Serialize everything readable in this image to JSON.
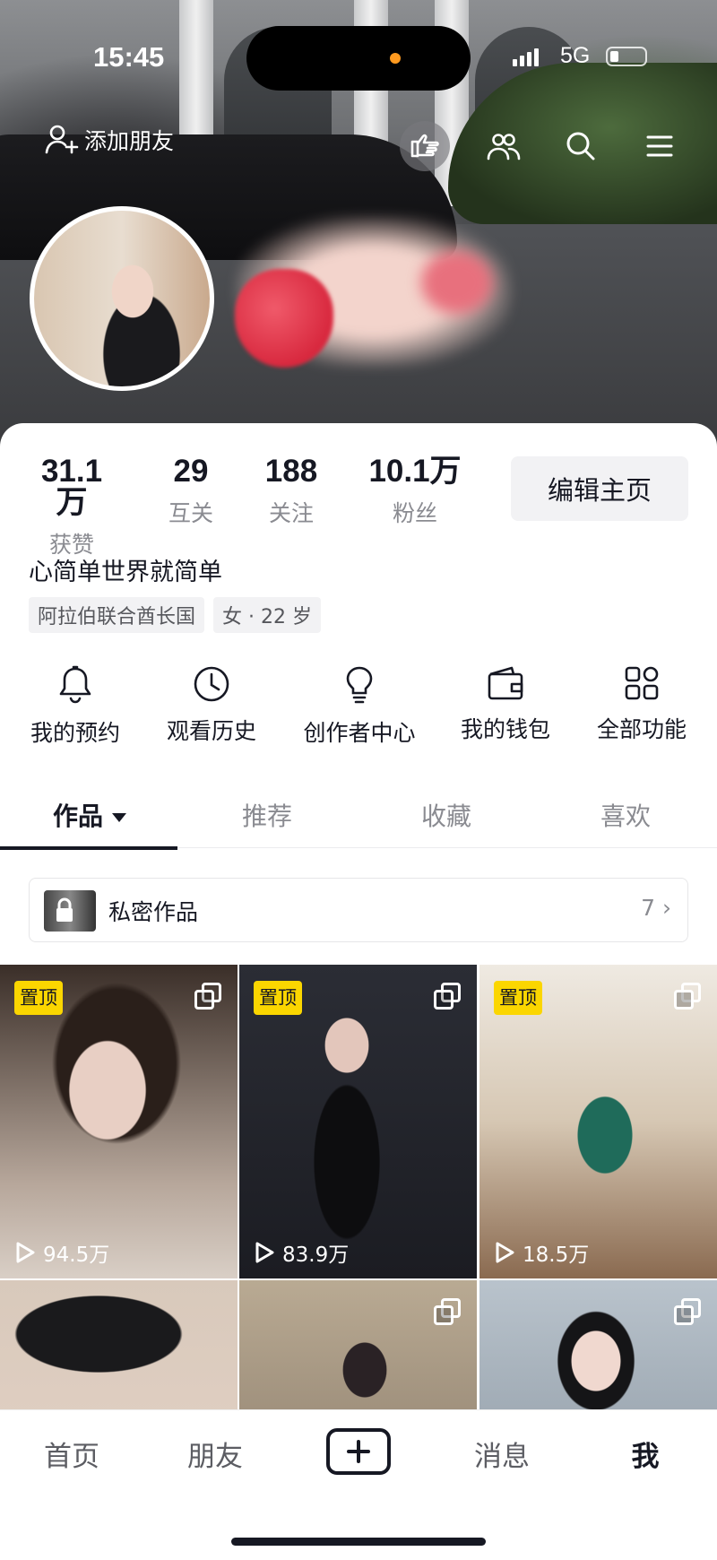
{
  "status_bar": {
    "time": "15:45",
    "network": "5G"
  },
  "header": {
    "add_friend_label": "添加朋友",
    "icons": [
      "add-friend-icon",
      "visitor-hand-icon",
      "friends-icon",
      "search-icon",
      "menu-icon"
    ]
  },
  "profile": {
    "stats": [
      {
        "value": "31.1万",
        "label": "获赞"
      },
      {
        "value": "29",
        "label": "互关"
      },
      {
        "value": "188",
        "label": "关注"
      },
      {
        "value": "10.1万",
        "label": "粉丝"
      }
    ],
    "edit_label": "编辑主页",
    "bio": "心简单世界就简单",
    "tags": [
      "阿拉伯联合酋长国",
      "女 · 22 岁"
    ]
  },
  "shortcuts": [
    {
      "label": "我的预约",
      "icon": "bell-icon"
    },
    {
      "label": "观看历史",
      "icon": "clock-icon"
    },
    {
      "label": "创作者中心",
      "icon": "lightbulb-icon"
    },
    {
      "label": "我的钱包",
      "icon": "wallet-icon"
    },
    {
      "label": "全部功能",
      "icon": "apps-grid-icon"
    }
  ],
  "tabs": [
    {
      "label": "作品"
    },
    {
      "label": "推荐"
    },
    {
      "label": "收藏"
    },
    {
      "label": "喜欢"
    }
  ],
  "private_works": {
    "label": "私密作品",
    "count": "7 ›"
  },
  "videos": [
    {
      "pinned": "置顶",
      "plays": "94.5万"
    },
    {
      "pinned": "置顶",
      "plays": "83.9万"
    },
    {
      "pinned": "置顶",
      "plays": "18.5万"
    },
    {
      "pinned": "",
      "plays": ""
    },
    {
      "pinned": "",
      "plays": ""
    },
    {
      "pinned": "",
      "plays": ""
    }
  ],
  "bottom_nav": [
    {
      "label": "首页"
    },
    {
      "label": "朋友"
    },
    {
      "label": "消息"
    },
    {
      "label": "我"
    }
  ],
  "colors": {
    "accent_pin": "#fbd600",
    "text_primary": "#161823",
    "text_secondary": "#8a8b91"
  }
}
